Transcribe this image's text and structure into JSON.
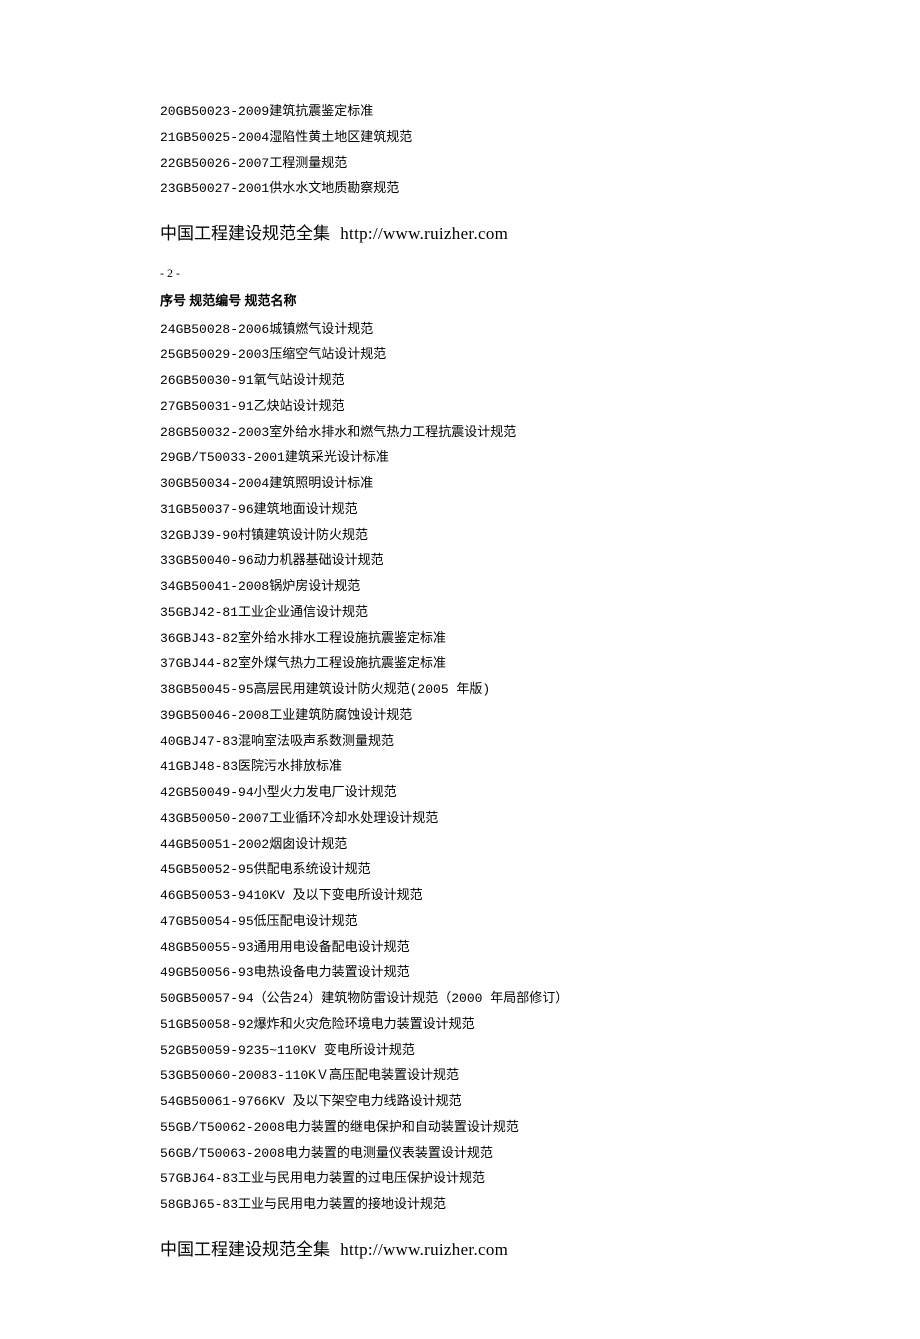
{
  "block1": {
    "items": [
      {
        "seq": "20",
        "code": "GB50023-2009",
        "name": "建筑抗震鉴定标准"
      },
      {
        "seq": "21",
        "code": "GB50025-2004",
        "name": "湿陷性黄土地区建筑规范"
      },
      {
        "seq": "22",
        "code": "GB50026-2007",
        "name": "工程测量规范"
      },
      {
        "seq": "23",
        "code": "GB50027-2001",
        "name": "供水水文地质勘察规范"
      }
    ]
  },
  "title": {
    "cn": "中国工程建设规范全集",
    "url": "http://www.ruizher.com"
  },
  "page_num": "- 2 -",
  "header": {
    "seq": "序号",
    "code": "规范编号",
    "name": "规范名称"
  },
  "block2": {
    "items": [
      {
        "seq": "24",
        "code": "GB50028-2006",
        "name": "城镇燃气设计规范"
      },
      {
        "seq": "25",
        "code": "GB50029-2003",
        "name": "压缩空气站设计规范"
      },
      {
        "seq": "26",
        "code": "GB50030-91",
        "name": "氧气站设计规范"
      },
      {
        "seq": "27",
        "code": "GB50031-91",
        "name": "乙炔站设计规范"
      },
      {
        "seq": "28",
        "code": "GB50032-2003",
        "name": "室外给水排水和燃气热力工程抗震设计规范"
      },
      {
        "seq": "29",
        "code": "GB/T50033-2001",
        "name": "建筑采光设计标准"
      },
      {
        "seq": "30",
        "code": "GB50034-2004",
        "name": "建筑照明设计标准"
      },
      {
        "seq": "31",
        "code": "GB50037-96",
        "name": "建筑地面设计规范"
      },
      {
        "seq": "32",
        "code": "GBJ39-90",
        "name": "村镇建筑设计防火规范"
      },
      {
        "seq": "33",
        "code": "GB50040-96",
        "name": "动力机器基础设计规范"
      },
      {
        "seq": "34",
        "code": "GB50041-2008",
        "name": "锅炉房设计规范"
      },
      {
        "seq": "35",
        "code": "GBJ42-81",
        "name": "工业企业通信设计规范"
      },
      {
        "seq": "36",
        "code": "GBJ43-82",
        "name": "室外给水排水工程设施抗震鉴定标准"
      },
      {
        "seq": "37",
        "code": "GBJ44-82",
        "name": "室外煤气热力工程设施抗震鉴定标准"
      },
      {
        "seq": "38",
        "code": "GB50045-95",
        "name": "高层民用建筑设计防火规范(2005 年版)"
      },
      {
        "seq": "39",
        "code": "GB50046-2008",
        "name": "工业建筑防腐蚀设计规范"
      },
      {
        "seq": "40",
        "code": "GBJ47-83",
        "name": "混响室法吸声系数测量规范"
      },
      {
        "seq": "41",
        "code": "GBJ48-83",
        "name": "医院污水排放标准"
      },
      {
        "seq": "42",
        "code": "GB50049-94",
        "name": "小型火力发电厂设计规范"
      },
      {
        "seq": "43",
        "code": "GB50050-2007",
        "name": "工业循环冷却水处理设计规范"
      },
      {
        "seq": "44",
        "code": "GB50051-2002",
        "name": "烟囱设计规范"
      },
      {
        "seq": "45",
        "code": "GB50052-95",
        "name": "供配电系统设计规范"
      },
      {
        "seq": "46",
        "code": "GB50053-94",
        "name": "10KV 及以下变电所设计规范"
      },
      {
        "seq": "47",
        "code": "GB50054-95",
        "name": "低压配电设计规范"
      },
      {
        "seq": "48",
        "code": "GB50055-93",
        "name": "通用用电设备配电设计规范"
      },
      {
        "seq": "49",
        "code": "GB50056-93",
        "name": "电热设备电力装置设计规范"
      },
      {
        "seq": "50",
        "code": "GB50057-94（公告24）",
        "name": " 建筑物防雷设计规范（2000 年局部修订）"
      },
      {
        "seq": "51",
        "code": "GB50058-92",
        "name": "爆炸和火灾危险环境电力装置设计规范"
      },
      {
        "seq": "52",
        "code": "GB50059-92",
        "name": "35~110KV 变电所设计规范"
      },
      {
        "seq": "53",
        "code": "GB50060-2008",
        "name": "3-110KＶ高压配电装置设计规范"
      },
      {
        "seq": "54",
        "code": "GB50061-97",
        "name": "66KV 及以下架空电力线路设计规范"
      },
      {
        "seq": "55",
        "code": "GB/T50062-2008",
        "name": "电力装置的继电保护和自动装置设计规范"
      },
      {
        "seq": "56",
        "code": "GB/T50063-2008",
        "name": "电力装置的电测量仪表装置设计规范"
      },
      {
        "seq": "57",
        "code": "GBJ64-83",
        "name": "工业与民用电力装置的过电压保护设计规范"
      },
      {
        "seq": "58",
        "code": "GBJ65-83",
        "name": "工业与民用电力装置的接地设计规范"
      }
    ]
  }
}
